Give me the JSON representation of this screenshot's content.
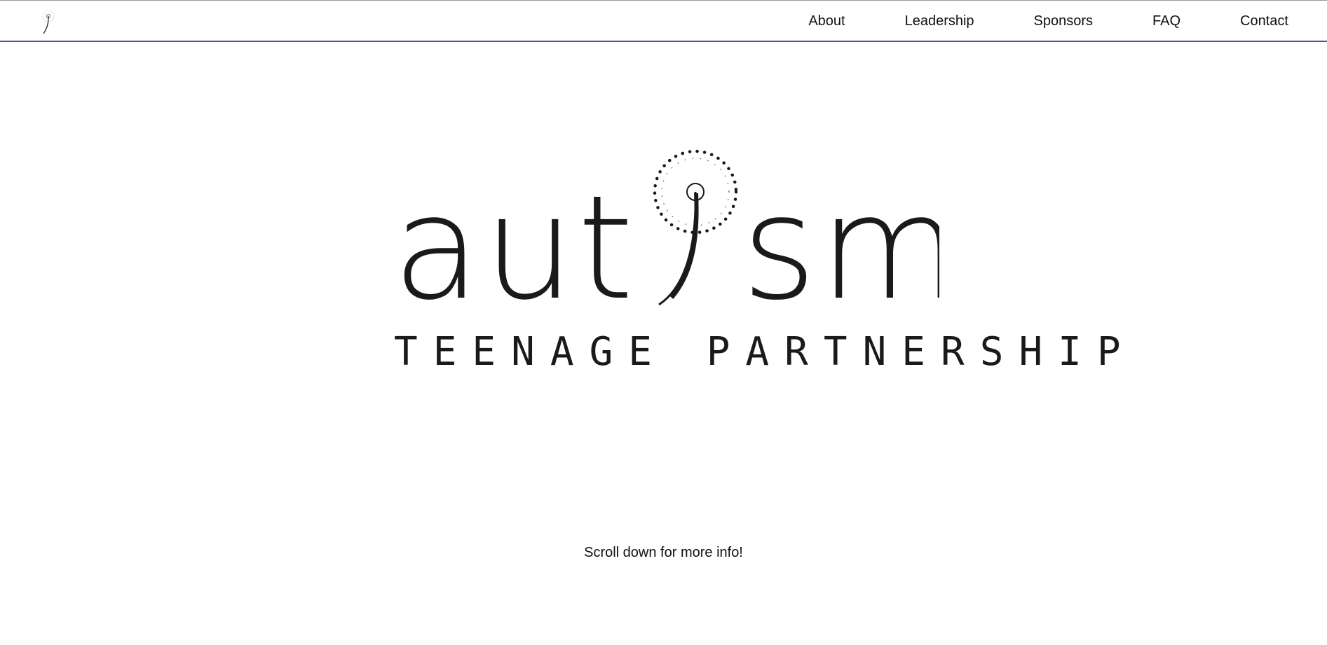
{
  "nav": {
    "logo_icon": "dandelion-logo-icon",
    "links": [
      {
        "label": "About"
      },
      {
        "label": "Leadership"
      },
      {
        "label": "Sponsors"
      },
      {
        "label": "FAQ"
      },
      {
        "label": "Contact"
      }
    ],
    "accent_color": "#4a4fb5"
  },
  "hero": {
    "logo_word_left": "aut",
    "logo_word_right": "sm",
    "logo_icon": "dandelion-i-icon",
    "tagline": "TEENAGE PARTNERSHIP"
  },
  "footer_hint": {
    "text": "Scroll down for more info!"
  }
}
